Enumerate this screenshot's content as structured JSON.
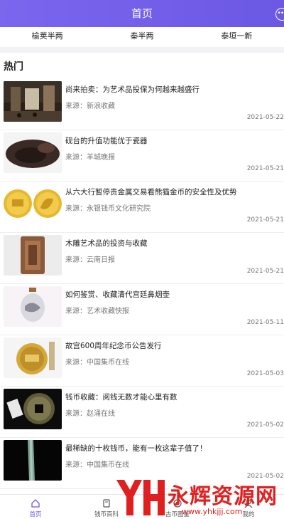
{
  "header": {
    "title": "首页"
  },
  "categories": [
    "榆荚半两",
    "秦半两",
    "泰垣一新"
  ],
  "hot": {
    "title": "热门",
    "items": [
      {
        "title": "尚来拍卖：为艺术品投保为何越来越盛行",
        "source": "来源：新浪收藏",
        "date": "2021-05-22"
      },
      {
        "title": "砚台的升值功能优于瓷器",
        "source": "来源：羊城晚报",
        "date": "2021-05-21"
      },
      {
        "title": "从六大行暂停贵金属交易看熊猫金币的安全性及优势",
        "source": "来源：永银钱币文化研究院",
        "date": "2021-05-21"
      },
      {
        "title": "木雕艺术品的投资与收藏",
        "source": "来源：云南日报",
        "date": "2021-05-21"
      },
      {
        "title": "如何鉴赏、收藏清代宫廷鼻烟壶",
        "source": "来源：艺术收藏快报",
        "date": "2021-05-11"
      },
      {
        "title": "故宫600周年纪念币公告发行",
        "source": "来源：中国集币在线",
        "date": "2021-05-03"
      },
      {
        "title": "钱币收藏：阅钱无数才能心里有数",
        "source": "来源：赵涌在线",
        "date": "2021-05-02"
      },
      {
        "title": "最稀缺的十枚钱币，能有一枚这辈子值了！",
        "source": "来源：中国集币在线",
        "date": "2021-05-02"
      }
    ]
  },
  "tabs": [
    {
      "label": "首页",
      "icon": "home-icon",
      "active": true
    },
    {
      "label": "钱币百科",
      "icon": "book-icon",
      "active": false
    },
    {
      "label": "古币图鉴",
      "icon": "coin-icon",
      "active": false
    },
    {
      "label": "我的",
      "icon": "user-icon",
      "active": false
    }
  ],
  "watermark": {
    "text": "永辉资源网",
    "url": "www.yhkjjj.com",
    "logo": "YH"
  },
  "colors": {
    "accent": "#6b58e3",
    "watermark": "#e02020"
  }
}
